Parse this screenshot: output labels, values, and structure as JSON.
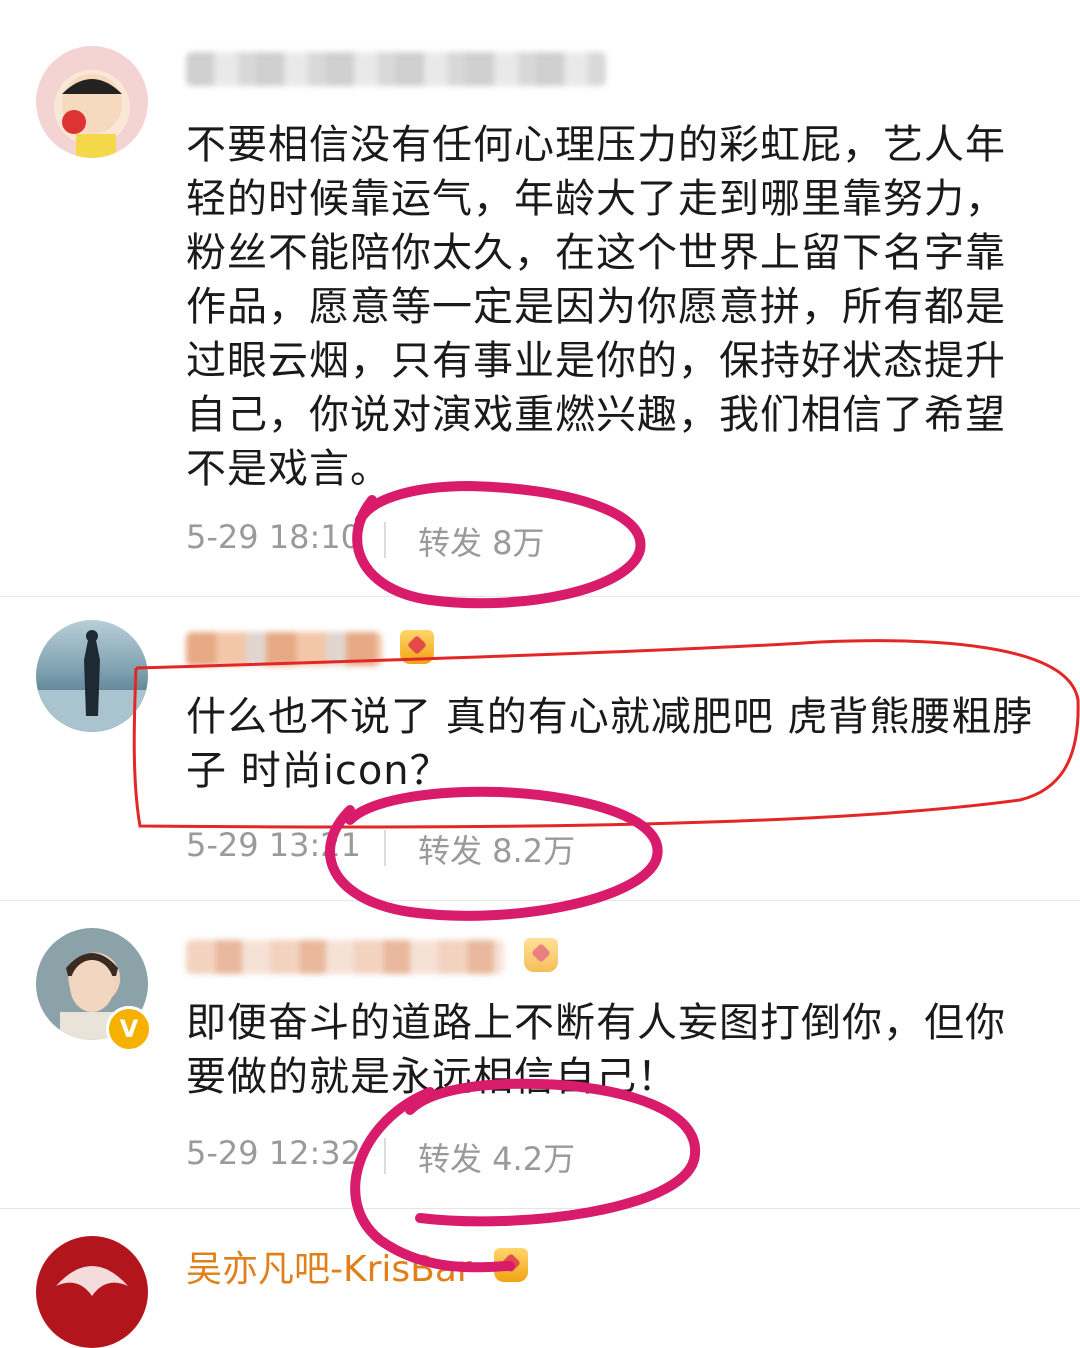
{
  "comments": [
    {
      "text": "不要相信没有任何心理压力的彩虹屁，艺人年轻的时候靠运气，年龄大了走到哪里靠努力，粉丝不能陪你太久，在这个世界上留下名字靠作品，愿意等一定是因为你愿意拼，所有都是过眼云烟，只有事业是你的，保持好状态提升自己，你说对演戏重燃兴趣，我们相信了希望不是戏言。",
      "time": "5-29 18:10",
      "repost": "转发 8万"
    },
    {
      "text": "什么也不说了 真的有心就减肥吧  虎背熊腰粗脖子 时尚icon？",
      "time": "5-29 13:21",
      "repost": "转发 8.2万"
    },
    {
      "text": "即便奋斗的道路上不断有人妄图打倒你，但你要做的就是永远相信自己！",
      "time": "5-29 12:32",
      "repost": "转发 4.2万"
    }
  ],
  "last_user": {
    "name": "吴亦凡吧-KrisBar"
  },
  "colors": {
    "annotation_pink": "#d81b6b",
    "annotation_red": "#e32626",
    "username_orange": "#e0801a",
    "meta_gray": "#9a9a9a"
  },
  "icons": [
    "crown-badge-icon",
    "verified-badge-icon"
  ]
}
